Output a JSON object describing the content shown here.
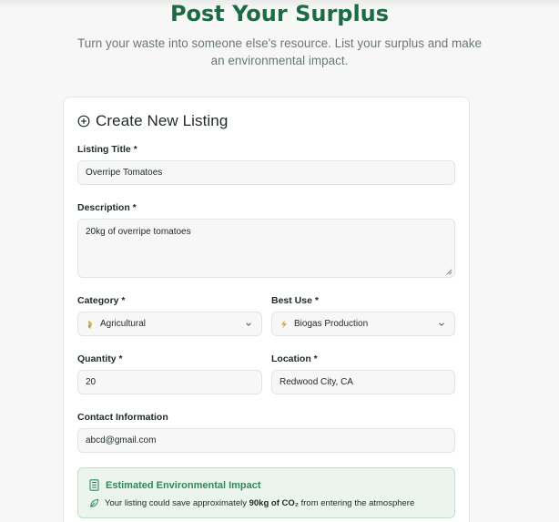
{
  "page": {
    "title": "Post Your Surplus",
    "subtitle": "Turn your waste into someone else's resource. List your surplus and make an environmental impact."
  },
  "form": {
    "heading": "Create New Listing",
    "listing_title": {
      "label": "Listing Title *",
      "value": "Overripe Tomatoes"
    },
    "description": {
      "label": "Description *",
      "value": "20kg of overripe tomatoes"
    },
    "category": {
      "label": "Category *",
      "value": "Agricultural",
      "icon": "wheat-icon"
    },
    "best_use": {
      "label": "Best Use *",
      "value": "Biogas Production",
      "icon": "lightning-icon"
    },
    "quantity": {
      "label": "Quantity *",
      "value": "20"
    },
    "location": {
      "label": "Location *",
      "value": "Redwood City, CA"
    },
    "contact": {
      "label": "Contact Information",
      "value": "abcd@gmail.com"
    }
  },
  "impact": {
    "title": "Estimated Environmental Impact",
    "text_before": "Your listing could save approximately",
    "amount": "90kg of CO₂",
    "text_after": "from entering the atmosphere",
    "color": "#2d8a57"
  },
  "colors": {
    "brand": "#1d6b45",
    "accent": "#2d8a57"
  }
}
